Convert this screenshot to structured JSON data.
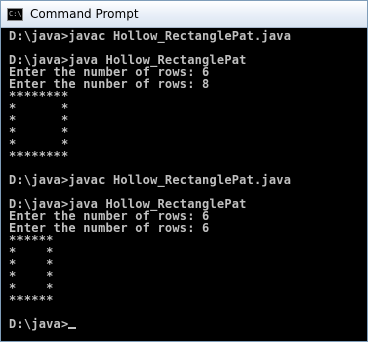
{
  "window": {
    "title": "Command Prompt",
    "icon": "cmd-icon",
    "icon_text": "C:\\."
  },
  "console": {
    "lines": [
      "D:\\java>javac Hollow_RectanglePat.java",
      "",
      "D:\\java>java Hollow_RectanglePat",
      "Enter the number of rows: 6",
      "Enter the nunber of rows: 8",
      "********",
      "*      *",
      "*      *",
      "*      *",
      "*      *",
      "********",
      "",
      "D:\\java>javac Hollow_RectanglePat.java",
      "",
      "D:\\java>java Hollow_RectanglePat",
      "Enter the number of rows: 6",
      "Enter the number of rows: 6",
      "******",
      "*    *",
      "*    *",
      "*    *",
      "*    *",
      "******",
      "",
      "D:\\java>"
    ]
  },
  "colors": {
    "console_bg": "#000000",
    "console_text": "#c0c0c0"
  }
}
